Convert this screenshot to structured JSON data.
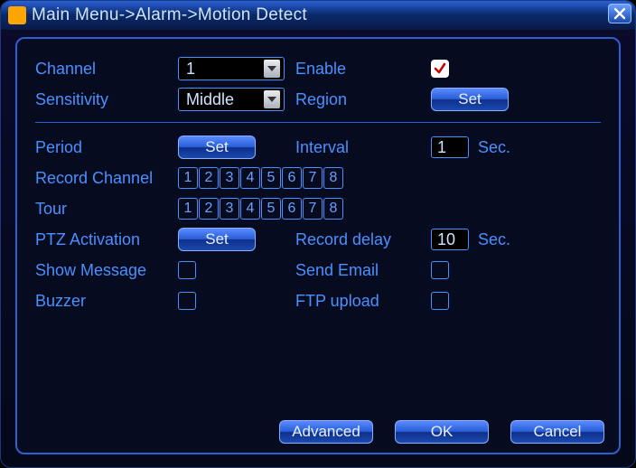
{
  "title": "Main Menu->Alarm->Motion Detect",
  "channel": {
    "label": "Channel",
    "value": "1"
  },
  "enable": {
    "label": "Enable",
    "checked": true
  },
  "sensitivity": {
    "label": "Sensitivity",
    "value": "Middle"
  },
  "region": {
    "label": "Region",
    "button": "Set"
  },
  "period": {
    "label": "Period",
    "button": "Set"
  },
  "interval": {
    "label": "Interval",
    "value": "1",
    "suffix": "Sec."
  },
  "record_channel": {
    "label": "Record Channel",
    "items": [
      "1",
      "2",
      "3",
      "4",
      "5",
      "6",
      "7",
      "8"
    ]
  },
  "tour": {
    "label": "Tour",
    "items": [
      "1",
      "2",
      "3",
      "4",
      "5",
      "6",
      "7",
      "8"
    ]
  },
  "ptz": {
    "label": "PTZ Activation",
    "button": "Set"
  },
  "record_delay": {
    "label": "Record delay",
    "value": "10",
    "suffix": "Sec."
  },
  "show_message": {
    "label": "Show Message",
    "checked": false
  },
  "send_email": {
    "label": "Send Email",
    "checked": false
  },
  "buzzer": {
    "label": "Buzzer",
    "checked": false
  },
  "ftp_upload": {
    "label": "FTP upload",
    "checked": false
  },
  "buttons": {
    "advanced": "Advanced",
    "ok": "OK",
    "cancel": "Cancel"
  }
}
